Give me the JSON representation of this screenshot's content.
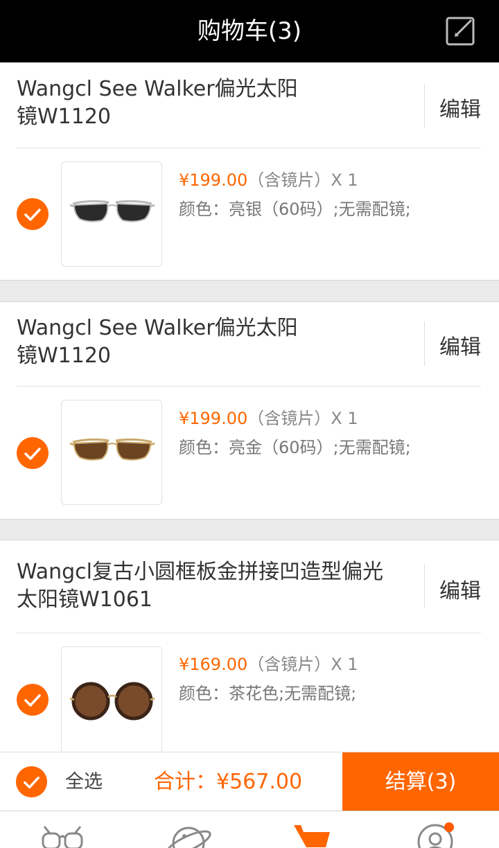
{
  "header": {
    "title": "购物车(3)",
    "edit_icon": "edit-icon"
  },
  "items": [
    {
      "name_line1": "Wangcl See Walker偏光太阳",
      "name_line2": "镜W1120",
      "edit_label": "编辑",
      "price": "¥199.00",
      "lens_note": "（含镜片）",
      "qty": "X 1",
      "spec": "颜色：亮银（60码）;无需配镜;",
      "checked": true,
      "lens_color": "#2b2b2b",
      "frame_color": "#b8b8b8"
    },
    {
      "name_line1": "Wangcl See Walker偏光太阳",
      "name_line2": "镜W1120",
      "edit_label": "编辑",
      "price": "¥199.00",
      "lens_note": "（含镜片）",
      "qty": "X 1",
      "spec": "颜色：亮金（60码）;无需配镜;",
      "checked": true,
      "lens_color": "#6b4421",
      "frame_color": "#c9a86a"
    },
    {
      "name_line1": "Wangcl复古小圆框板金拼接凹造型偏光",
      "name_line2": "太阳镜W1061",
      "edit_label": "编辑",
      "price": "¥169.00",
      "lens_note": "（含镜片）",
      "qty": "X 1",
      "spec": "颜色：茶花色;无需配镜;",
      "checked": true,
      "lens_color": "#7a4b2a",
      "frame_color": "#3b2418"
    }
  ],
  "footer": {
    "select_all_label": "全选",
    "total_label": "合计：",
    "total_value": "¥567.00",
    "checkout_label": "结算(3)"
  },
  "tabbar": {
    "tabs": [
      {
        "icon": "glasses-icon",
        "active": false
      },
      {
        "icon": "planet-icon",
        "active": false
      },
      {
        "icon": "cart-icon",
        "active": true
      },
      {
        "icon": "user-icon",
        "active": false,
        "badge": true
      }
    ]
  },
  "colors": {
    "accent": "#ff6600",
    "header_bg": "#000000"
  }
}
